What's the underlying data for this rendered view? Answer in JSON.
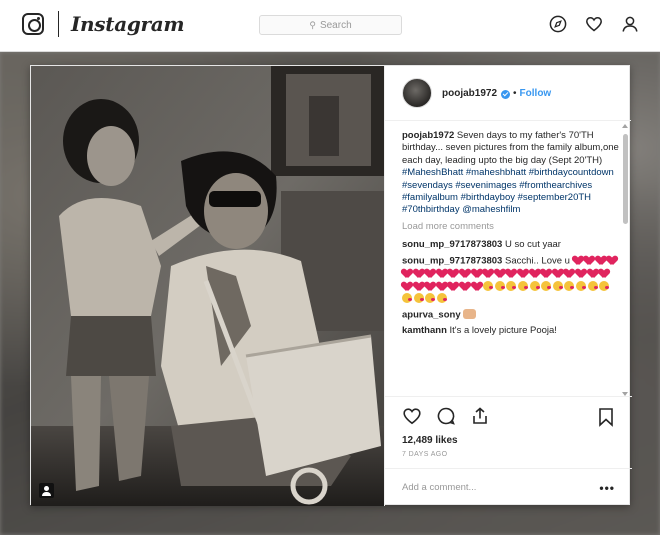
{
  "header": {
    "wordmark": "Instagram",
    "search_placeholder": "Search",
    "icons": [
      "instagram-logo-icon",
      "explore-compass-icon",
      "activity-heart-icon",
      "profile-person-icon"
    ]
  },
  "post": {
    "username": "poojab1972",
    "separator": "•",
    "follow_label": "Follow",
    "caption_user": "poojab1972",
    "caption_text": "Seven days to my father's 70'TH birthday... seven pictures from the family album,one each day, leading upto the big day (Sept 20'TH)",
    "hashtags": "#MaheshBhatt #maheshbhatt #birthdaycountdown #sevendays #sevenimages #fromthearchives #familyalbum #birthdayboy #september20TH #70thbirthday @maheshfilm",
    "load_more": "Load more comments",
    "comments": [
      {
        "user": "sonu_mp_9717873803",
        "text": "U so cut yaar"
      },
      {
        "user": "sonu_mp_9717873803",
        "text": "Sacchi.. Love u"
      },
      {
        "user": "apurva_sony",
        "text": ""
      },
      {
        "user": "kamthann",
        "text": "It's a lovely picture Pooja!"
      }
    ],
    "likes": "12,489 likes",
    "time_ago": "7 DAYS AGO",
    "add_comment_placeholder": "Add a comment...",
    "more_options": "•••",
    "colors": {
      "link": "#3897f0",
      "hashtag": "#003569",
      "heart": "#e0245e"
    }
  }
}
